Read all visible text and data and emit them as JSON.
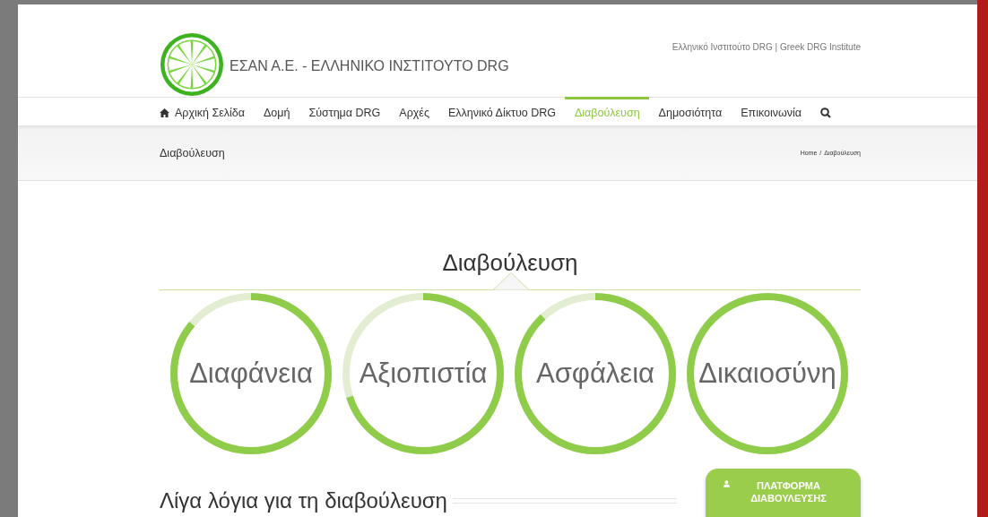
{
  "header": {
    "site_title": "ΕΣΑΝ Α.Ε. - ΕΛΛΗΝΙΚΟ ΙΝΣΤΙΤΟΥΤΟ DRG",
    "tagline": "Ελληνικό Ινστιτούτο DRG | Greek DRG Institute"
  },
  "nav": [
    {
      "label": "Αρχική Σελίδα",
      "kind": "home",
      "selected": false
    },
    {
      "label": "Δομή",
      "kind": "link",
      "selected": false
    },
    {
      "label": "Σύστημα DRG",
      "kind": "link",
      "selected": false
    },
    {
      "label": "Αρχές",
      "kind": "link",
      "selected": false
    },
    {
      "label": "Ελληνικό Δίκτυο DRG",
      "kind": "link",
      "selected": false
    },
    {
      "label": "Διαβούλευση",
      "kind": "link",
      "selected": true
    },
    {
      "label": "Δημοσιότητα",
      "kind": "link",
      "selected": false
    },
    {
      "label": "Επικοινωνία",
      "kind": "link",
      "selected": false
    },
    {
      "kind": "search",
      "selected": false
    }
  ],
  "page_title_bar": {
    "title": "Διαβούλευση",
    "breadcrumb": [
      {
        "label": "Home"
      },
      {
        "label": "Διαβούλευση"
      }
    ],
    "separator": "/"
  },
  "section_title": "Διαβούλευση",
  "gauges": [
    {
      "label": "Διαφάνεια"
    },
    {
      "label": "Αξιοπιστία"
    },
    {
      "label": "Ασφάλεια"
    },
    {
      "label": "Δικαιοσύνη"
    }
  ],
  "about_heading": "Λίγα λόγια για τη διαβούλευση",
  "platform_button": {
    "label": "ΠΛΑΤΦΟΡΜΑ ΔΙΑΒΟΥΛΕΥΣΗΣ"
  }
}
